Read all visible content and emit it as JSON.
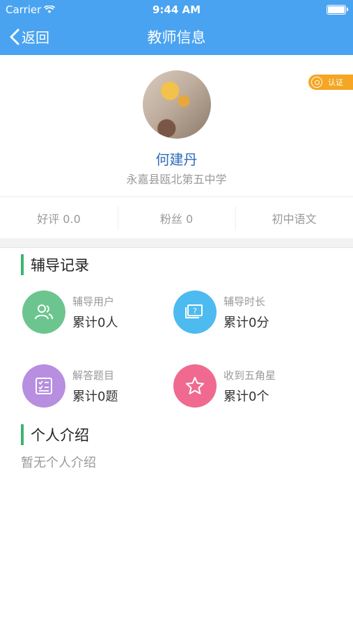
{
  "status_bar": {
    "carrier": "Carrier",
    "time": "9:44 AM"
  },
  "nav": {
    "back_label": "返回",
    "title": "教师信息"
  },
  "profile": {
    "name": "何建丹",
    "school": "永嘉县瓯北第五中学",
    "cert_label": "认证"
  },
  "stats": [
    {
      "label": "好评 0.0"
    },
    {
      "label": "粉丝 0"
    },
    {
      "label": "初中语文"
    }
  ],
  "tutoring": {
    "title": "辅导记录",
    "items": [
      {
        "label": "辅导用户",
        "value": "累计0人",
        "icon": "users-icon",
        "color": "#6cc58f"
      },
      {
        "label": "辅导时长",
        "value": "累计0分",
        "icon": "question-screen-icon",
        "color": "#4dbbef"
      },
      {
        "label": "解答题目",
        "value": "累计0题",
        "icon": "checklist-icon",
        "color": "#b78ee0"
      },
      {
        "label": "收到五角星",
        "value": "累计0个",
        "icon": "star-icon",
        "color": "#f06a8f"
      }
    ]
  },
  "intro": {
    "title": "个人介绍",
    "text": "暂无个人介绍"
  }
}
